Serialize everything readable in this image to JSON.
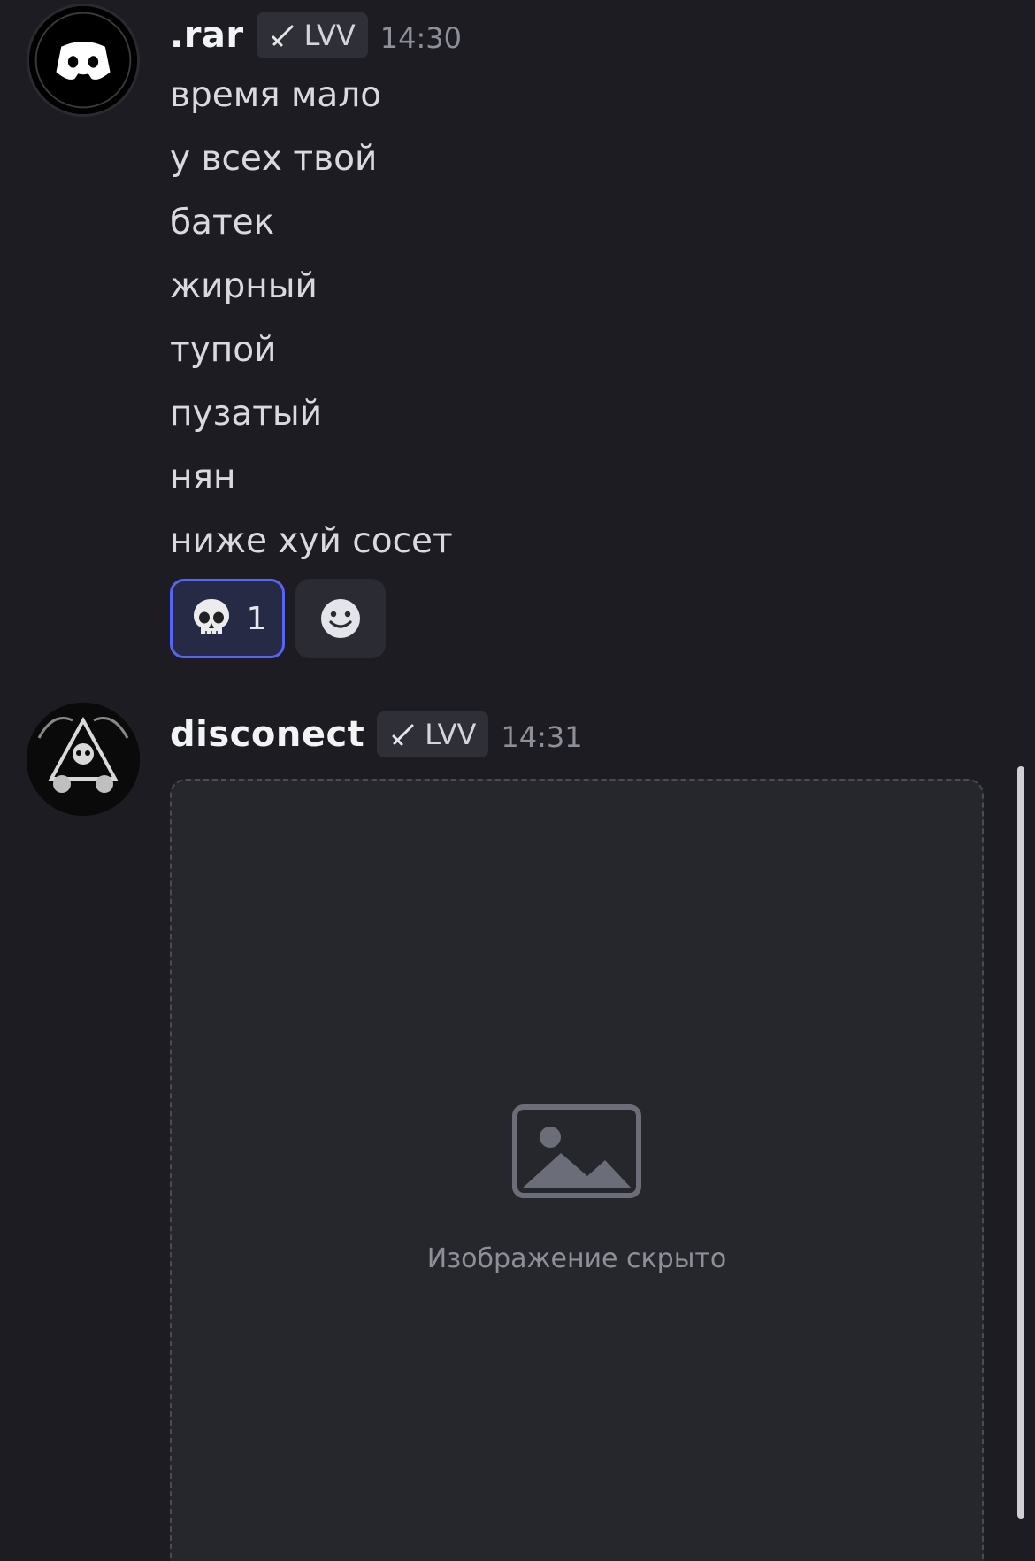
{
  "messages": [
    {
      "username": ".rar",
      "tag": "LVV",
      "time": "14:30",
      "lines": [
        "время мало",
        "у всех твой",
        "батек",
        "жирный",
        "тупой",
        "пузатый",
        "нян",
        "ниже хуй сосет"
      ],
      "reactions": [
        {
          "emoji": "skull-icon",
          "count": "1",
          "active": true
        },
        {
          "emoji": "add-reaction-icon"
        }
      ]
    },
    {
      "username": "disconect",
      "tag": "LVV",
      "time": "14:31",
      "attachment": {
        "type": "image",
        "caption": "Изображение скрыто"
      }
    }
  ],
  "colors": {
    "background": "#1c1c22",
    "accent": "#5865f2",
    "username": "#f2f3f5",
    "timestamp": "#8d8f99",
    "tag_background": "#2e2f37"
  }
}
